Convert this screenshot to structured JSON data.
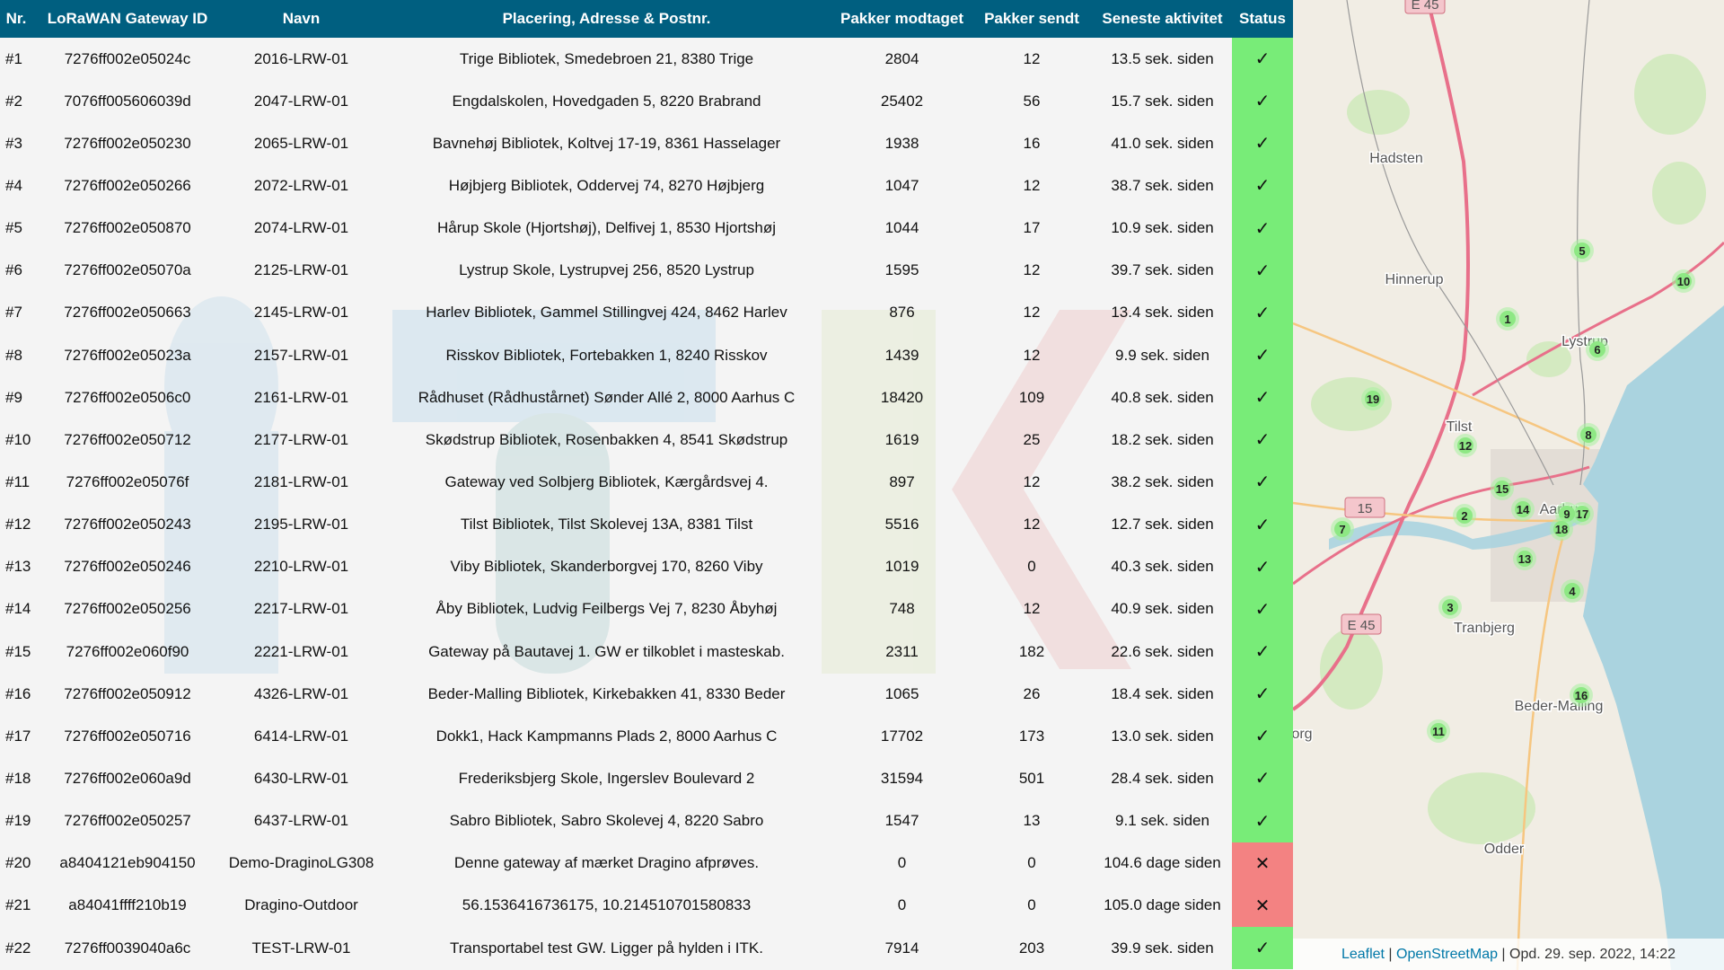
{
  "table": {
    "headers": [
      "Nr.",
      "LoRaWAN Gateway ID",
      "Navn",
      "Placering, Adresse & Postnr.",
      "Pakker modtaget",
      "Pakker sendt",
      "Seneste aktivitet",
      "Status"
    ],
    "rows": [
      {
        "nr": "#1",
        "id": "7276ff002e05024c",
        "name": "2016-LRW-01",
        "location": "Trige Bibliotek, Smedebroen 21, 8380 Trige",
        "received": "2804",
        "sent": "12",
        "last": "13.5 sek. siden",
        "status": "online"
      },
      {
        "nr": "#2",
        "id": "7076ff005606039d",
        "name": "2047-LRW-01",
        "location": "Engdalskolen, Hovedgaden 5, 8220 Brabrand",
        "received": "25402",
        "sent": "56",
        "last": "15.7 sek. siden",
        "status": "online"
      },
      {
        "nr": "#3",
        "id": "7276ff002e050230",
        "name": "2065-LRW-01",
        "location": "Bavnehøj Bibliotek, Koltvej 17-19, 8361 Hasselager",
        "received": "1938",
        "sent": "16",
        "last": "41.0 sek. siden",
        "status": "online"
      },
      {
        "nr": "#4",
        "id": "7276ff002e050266",
        "name": "2072-LRW-01",
        "location": "Højbjerg Bibliotek, Oddervej 74, 8270 Højbjerg",
        "received": "1047",
        "sent": "12",
        "last": "38.7 sek. siden",
        "status": "online"
      },
      {
        "nr": "#5",
        "id": "7276ff002e050870",
        "name": "2074-LRW-01",
        "location": "Hårup Skole (Hjortshøj), Delfivej 1, 8530 Hjortshøj",
        "received": "1044",
        "sent": "17",
        "last": "10.9 sek. siden",
        "status": "online"
      },
      {
        "nr": "#6",
        "id": "7276ff002e05070a",
        "name": "2125-LRW-01",
        "location": "Lystrup Skole, Lystrupvej 256, 8520 Lystrup",
        "received": "1595",
        "sent": "12",
        "last": "39.7 sek. siden",
        "status": "online"
      },
      {
        "nr": "#7",
        "id": "7276ff002e050663",
        "name": "2145-LRW-01",
        "location": "Harlev Bibliotek, Gammel Stillingvej 424, 8462 Harlev",
        "received": "876",
        "sent": "12",
        "last": "13.4 sek. siden",
        "status": "online"
      },
      {
        "nr": "#8",
        "id": "7276ff002e05023a",
        "name": "2157-LRW-01",
        "location": "Risskov Bibliotek, Fortebakken 1, 8240 Risskov",
        "received": "1439",
        "sent": "12",
        "last": "9.9 sek. siden",
        "status": "online"
      },
      {
        "nr": "#9",
        "id": "7276ff002e0506c0",
        "name": "2161-LRW-01",
        "location": "Rådhuset (Rådhustårnet) Sønder Allé 2, 8000 Aarhus C",
        "received": "18420",
        "sent": "109",
        "last": "40.8 sek. siden",
        "status": "online"
      },
      {
        "nr": "#10",
        "id": "7276ff002e050712",
        "name": "2177-LRW-01",
        "location": "Skødstrup Bibliotek, Rosenbakken 4, 8541 Skødstrup",
        "received": "1619",
        "sent": "25",
        "last": "18.2 sek. siden",
        "status": "online"
      },
      {
        "nr": "#11",
        "id": "7276ff002e05076f",
        "name": "2181-LRW-01",
        "location": "Gateway ved Solbjerg Bibliotek, Kærgårdsvej 4.",
        "received": "897",
        "sent": "12",
        "last": "38.2 sek. siden",
        "status": "online"
      },
      {
        "nr": "#12",
        "id": "7276ff002e050243",
        "name": "2195-LRW-01",
        "location": "Tilst Bibliotek, Tilst Skolevej 13A, 8381 Tilst",
        "received": "5516",
        "sent": "12",
        "last": "12.7 sek. siden",
        "status": "online"
      },
      {
        "nr": "#13",
        "id": "7276ff002e050246",
        "name": "2210-LRW-01",
        "location": "Viby Bibliotek, Skanderborgvej 170, 8260 Viby",
        "received": "1019",
        "sent": "0",
        "last": "40.3 sek. siden",
        "status": "online"
      },
      {
        "nr": "#14",
        "id": "7276ff002e050256",
        "name": "2217-LRW-01",
        "location": "Åby Bibliotek, Ludvig Feilbergs Vej 7, 8230 Åbyhøj",
        "received": "748",
        "sent": "12",
        "last": "40.9 sek. siden",
        "status": "online"
      },
      {
        "nr": "#15",
        "id": "7276ff002e060f90",
        "name": "2221-LRW-01",
        "location": "Gateway på Bautavej 1. GW er tilkoblet i masteskab.",
        "received": "2311",
        "sent": "182",
        "last": "22.6 sek. siden",
        "status": "online"
      },
      {
        "nr": "#16",
        "id": "7276ff002e050912",
        "name": "4326-LRW-01",
        "location": "Beder-Malling Bibliotek, Kirkebakken 41, 8330 Beder",
        "received": "1065",
        "sent": "26",
        "last": "18.4 sek. siden",
        "status": "online"
      },
      {
        "nr": "#17",
        "id": "7276ff002e050716",
        "name": "6414-LRW-01",
        "location": "Dokk1, Hack Kampmanns Plads 2, 8000 Aarhus C",
        "received": "17702",
        "sent": "173",
        "last": "13.0 sek. siden",
        "status": "online"
      },
      {
        "nr": "#18",
        "id": "7276ff002e060a9d",
        "name": "6430-LRW-01",
        "location": "Frederiksbjerg Skole, Ingerslev Boulevard 2",
        "received": "31594",
        "sent": "501",
        "last": "28.4 sek. siden",
        "status": "online"
      },
      {
        "nr": "#19",
        "id": "7276ff002e050257",
        "name": "6437-LRW-01",
        "location": "Sabro Bibliotek, Sabro Skolevej 4, 8220 Sabro",
        "received": "1547",
        "sent": "13",
        "last": "9.1 sek. siden",
        "status": "online"
      },
      {
        "nr": "#20",
        "id": "a8404121eb904150",
        "name": "Demo-DraginoLG308",
        "location": "Denne gateway af mærket Dragino afprøves.",
        "received": "0",
        "sent": "0",
        "last": "104.6 dage siden",
        "status": "offline"
      },
      {
        "nr": "#21",
        "id": "a84041ffff210b19",
        "name": "Dragino-Outdoor",
        "location": "56.1536416736175, 10.214510701580833",
        "received": "0",
        "sent": "0",
        "last": "105.0 dage siden",
        "status": "offline"
      },
      {
        "nr": "#22",
        "id": "7276ff0039040a6c",
        "name": "TEST-LRW-01",
        "location": "Transportabel test GW. Ligger på hylden i ITK.",
        "received": "7914",
        "sent": "203",
        "last": "39.9 sek. siden",
        "status": "online"
      }
    ],
    "status_symbols": {
      "online": "✓",
      "offline": "✕"
    },
    "colors": {
      "header": "#005f80",
      "online": "#78ec78",
      "offline": "#f38282"
    }
  },
  "map": {
    "places": [
      "Hadsten",
      "Hinnerup",
      "Tranbjerg",
      "Beder-Malling",
      "Odder",
      "Tilst",
      "Lystrup",
      "Aarhus",
      "org"
    ],
    "road_shields": [
      "E 45",
      "15",
      "E 45"
    ],
    "markers": [
      "5",
      "10",
      "1",
      "6",
      "19",
      "8",
      "12",
      "15",
      "14",
      "2",
      "17",
      "9",
      "18",
      "7",
      "13",
      "4",
      "3",
      "16",
      "11"
    ],
    "attribution": {
      "leaflet": "Leaflet",
      "osm": "OpenStreetMap",
      "sep": " | ",
      "updated": "Opd. 29. sep. 2022, 14:22"
    },
    "colors": {
      "land": "#f1ede4",
      "sea": "#aad3df",
      "marker": "#a8f0a0",
      "motorway": "#e8708a"
    }
  }
}
